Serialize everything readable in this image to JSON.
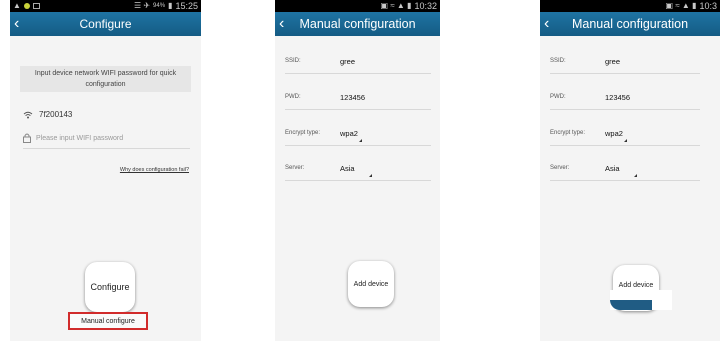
{
  "screen1": {
    "status_time": "15:25",
    "status_battery": "94%",
    "title": "Configure",
    "info_text": "Input device network WIFI password for quick configuration",
    "wifi_name": "7f200143",
    "password_placeholder": "Please input WIFI password",
    "help_link": "Why does configuration fail?",
    "configure_button": "Configure",
    "manual_button": "Manual configure",
    "highlight_color": "#d12b2b"
  },
  "screen2": {
    "status_time": "10:32",
    "title": "Manual configuration",
    "fields": [
      {
        "label": "SSID:",
        "value": "gree"
      },
      {
        "label": "PWD:",
        "value": "123456"
      },
      {
        "label": "Encrypt type:",
        "value": "wpa2"
      },
      {
        "label": "Server:",
        "value": "Asia"
      }
    ],
    "add_button": "Add device"
  },
  "screen3": {
    "status_time": "10:3",
    "title": "Manual configuration",
    "fields": [
      {
        "label": "SSID:",
        "value": "gree"
      },
      {
        "label": "PWD:",
        "value": "123456"
      },
      {
        "label": "Encrypt type:",
        "value": "wpa2"
      },
      {
        "label": "Server:",
        "value": "Asia"
      }
    ],
    "add_button": "Add device"
  },
  "theme": {
    "titlebar": "#1a6894",
    "accent_pressed": "#205c84"
  }
}
